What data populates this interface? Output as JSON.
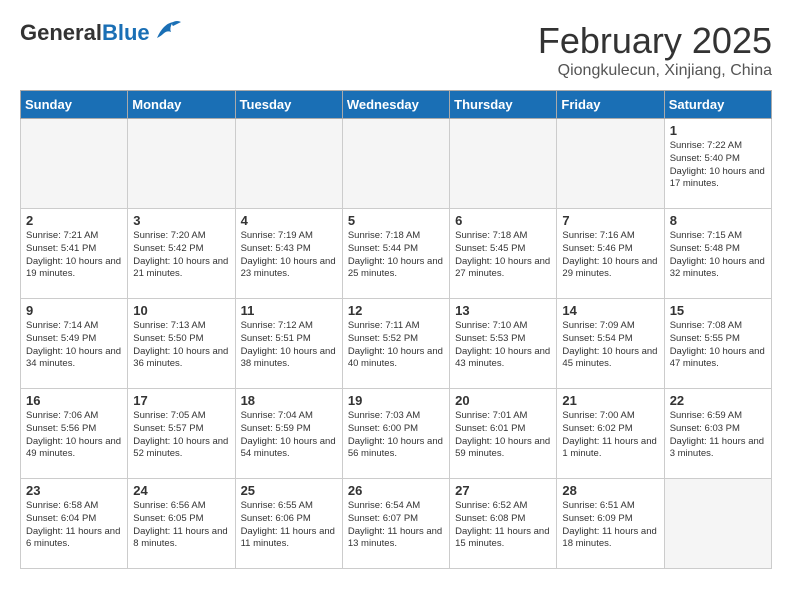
{
  "header": {
    "logo_general": "General",
    "logo_blue": "Blue",
    "month_title": "February 2025",
    "location": "Qiongkulecun, Xinjiang, China"
  },
  "days_of_week": [
    "Sunday",
    "Monday",
    "Tuesday",
    "Wednesday",
    "Thursday",
    "Friday",
    "Saturday"
  ],
  "weeks": [
    [
      {
        "day": "",
        "info": ""
      },
      {
        "day": "",
        "info": ""
      },
      {
        "day": "",
        "info": ""
      },
      {
        "day": "",
        "info": ""
      },
      {
        "day": "",
        "info": ""
      },
      {
        "day": "",
        "info": ""
      },
      {
        "day": "1",
        "info": "Sunrise: 7:22 AM\nSunset: 5:40 PM\nDaylight: 10 hours and 17 minutes."
      }
    ],
    [
      {
        "day": "2",
        "info": "Sunrise: 7:21 AM\nSunset: 5:41 PM\nDaylight: 10 hours and 19 minutes."
      },
      {
        "day": "3",
        "info": "Sunrise: 7:20 AM\nSunset: 5:42 PM\nDaylight: 10 hours and 21 minutes."
      },
      {
        "day": "4",
        "info": "Sunrise: 7:19 AM\nSunset: 5:43 PM\nDaylight: 10 hours and 23 minutes."
      },
      {
        "day": "5",
        "info": "Sunrise: 7:18 AM\nSunset: 5:44 PM\nDaylight: 10 hours and 25 minutes."
      },
      {
        "day": "6",
        "info": "Sunrise: 7:18 AM\nSunset: 5:45 PM\nDaylight: 10 hours and 27 minutes."
      },
      {
        "day": "7",
        "info": "Sunrise: 7:16 AM\nSunset: 5:46 PM\nDaylight: 10 hours and 29 minutes."
      },
      {
        "day": "8",
        "info": "Sunrise: 7:15 AM\nSunset: 5:48 PM\nDaylight: 10 hours and 32 minutes."
      }
    ],
    [
      {
        "day": "9",
        "info": "Sunrise: 7:14 AM\nSunset: 5:49 PM\nDaylight: 10 hours and 34 minutes."
      },
      {
        "day": "10",
        "info": "Sunrise: 7:13 AM\nSunset: 5:50 PM\nDaylight: 10 hours and 36 minutes."
      },
      {
        "day": "11",
        "info": "Sunrise: 7:12 AM\nSunset: 5:51 PM\nDaylight: 10 hours and 38 minutes."
      },
      {
        "day": "12",
        "info": "Sunrise: 7:11 AM\nSunset: 5:52 PM\nDaylight: 10 hours and 40 minutes."
      },
      {
        "day": "13",
        "info": "Sunrise: 7:10 AM\nSunset: 5:53 PM\nDaylight: 10 hours and 43 minutes."
      },
      {
        "day": "14",
        "info": "Sunrise: 7:09 AM\nSunset: 5:54 PM\nDaylight: 10 hours and 45 minutes."
      },
      {
        "day": "15",
        "info": "Sunrise: 7:08 AM\nSunset: 5:55 PM\nDaylight: 10 hours and 47 minutes."
      }
    ],
    [
      {
        "day": "16",
        "info": "Sunrise: 7:06 AM\nSunset: 5:56 PM\nDaylight: 10 hours and 49 minutes."
      },
      {
        "day": "17",
        "info": "Sunrise: 7:05 AM\nSunset: 5:57 PM\nDaylight: 10 hours and 52 minutes."
      },
      {
        "day": "18",
        "info": "Sunrise: 7:04 AM\nSunset: 5:59 PM\nDaylight: 10 hours and 54 minutes."
      },
      {
        "day": "19",
        "info": "Sunrise: 7:03 AM\nSunset: 6:00 PM\nDaylight: 10 hours and 56 minutes."
      },
      {
        "day": "20",
        "info": "Sunrise: 7:01 AM\nSunset: 6:01 PM\nDaylight: 10 hours and 59 minutes."
      },
      {
        "day": "21",
        "info": "Sunrise: 7:00 AM\nSunset: 6:02 PM\nDaylight: 11 hours and 1 minute."
      },
      {
        "day": "22",
        "info": "Sunrise: 6:59 AM\nSunset: 6:03 PM\nDaylight: 11 hours and 3 minutes."
      }
    ],
    [
      {
        "day": "23",
        "info": "Sunrise: 6:58 AM\nSunset: 6:04 PM\nDaylight: 11 hours and 6 minutes."
      },
      {
        "day": "24",
        "info": "Sunrise: 6:56 AM\nSunset: 6:05 PM\nDaylight: 11 hours and 8 minutes."
      },
      {
        "day": "25",
        "info": "Sunrise: 6:55 AM\nSunset: 6:06 PM\nDaylight: 11 hours and 11 minutes."
      },
      {
        "day": "26",
        "info": "Sunrise: 6:54 AM\nSunset: 6:07 PM\nDaylight: 11 hours and 13 minutes."
      },
      {
        "day": "27",
        "info": "Sunrise: 6:52 AM\nSunset: 6:08 PM\nDaylight: 11 hours and 15 minutes."
      },
      {
        "day": "28",
        "info": "Sunrise: 6:51 AM\nSunset: 6:09 PM\nDaylight: 11 hours and 18 minutes."
      },
      {
        "day": "",
        "info": ""
      }
    ]
  ]
}
